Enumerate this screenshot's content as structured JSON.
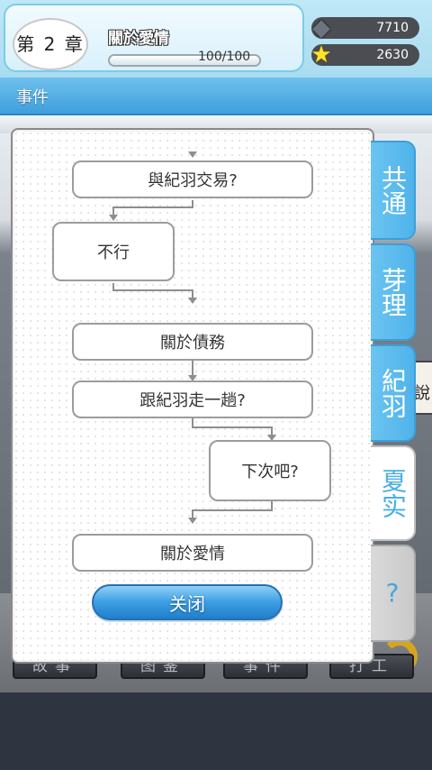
{
  "header": {
    "chapter_label": "第 2 章",
    "title": "關於愛情",
    "progress_text": "100/100",
    "progress_fraction": 1.0
  },
  "resources": [
    {
      "icon": "gem-icon",
      "value": "7710"
    },
    {
      "icon": "star-icon",
      "value": "2630"
    }
  ],
  "section": {
    "label": "事件"
  },
  "flow": {
    "nodes": [
      {
        "label": "與紀羽交易?"
      },
      {
        "label": "不行"
      },
      {
        "label": "關於債務"
      },
      {
        "label": "跟紀羽走一趟?"
      },
      {
        "label": "下次吧?"
      },
      {
        "label": "關於愛情"
      }
    ]
  },
  "dialog": {
    "close_label": "关闭"
  },
  "tabs": [
    {
      "label": "共通",
      "active": false
    },
    {
      "label": "芽理",
      "active": false
    },
    {
      "label": "紀羽",
      "active": false
    },
    {
      "label": "夏实",
      "active": true
    },
    {
      "label": "?",
      "active": false
    }
  ],
  "background": {
    "nav_buttons": [
      "故事",
      "图鉴",
      "事件",
      "打工"
    ],
    "sign_text": "說"
  },
  "colors": {
    "accent_blue": "#4fb3eb",
    "header_bg": "#aadcf0",
    "section_bar": "#3f9fdc"
  }
}
